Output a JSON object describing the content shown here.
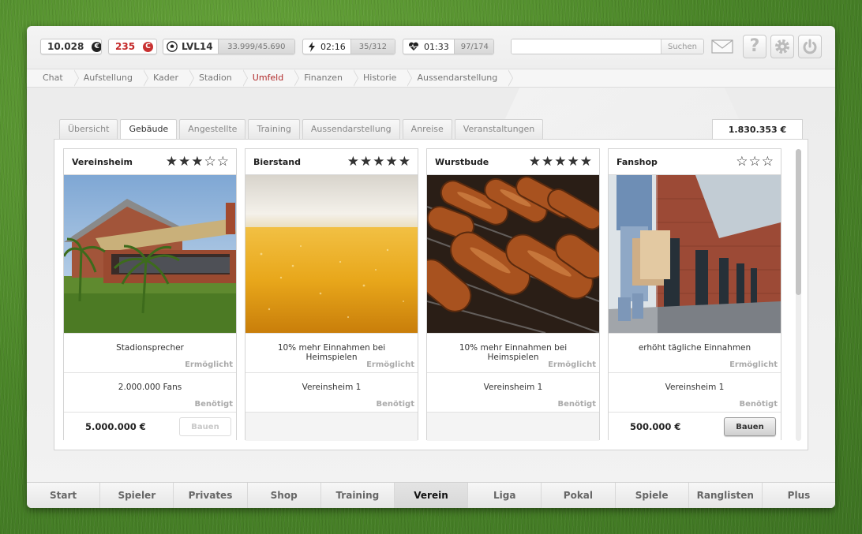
{
  "status": {
    "euro": "10.028",
    "euro_symbol": "€",
    "credits": "235",
    "credits_symbol": "C",
    "level": "LVL14",
    "xp": "33.999/45.690",
    "energy_time": "02:16",
    "energy": "35/312",
    "health_time": "01:33",
    "health": "97/174"
  },
  "search": {
    "value": "",
    "button": "Suchen"
  },
  "breadcrumbs": [
    "Chat",
    "Aufstellung",
    "Kader",
    "Stadion",
    "Umfeld",
    "Finanzen",
    "Historie",
    "Aussendarstellung"
  ],
  "breadcrumb_active": "Umfeld",
  "tabs": [
    "Übersicht",
    "Gebäude",
    "Angestellte",
    "Training",
    "Aussendarstellung",
    "Anreise",
    "Veranstaltungen"
  ],
  "tab_active": "Gebäude",
  "balance": "1.830.353 €",
  "cards": [
    {
      "title": "Vereinsheim",
      "stars": "★★★☆☆",
      "effect": "Stadionsprecher",
      "effect_label": "Ermöglicht",
      "requirement": "2.000.000 Fans",
      "requirement_label": "Benötigt",
      "price": "5.000.000 €",
      "button": "Bauen",
      "button_enabled": false
    },
    {
      "title": "Bierstand",
      "stars": "★★★★★",
      "effect": "10% mehr Einnahmen bei Heimspielen",
      "effect_label": "Ermöglicht",
      "requirement": "Vereinsheim 1",
      "requirement_label": "Benötigt",
      "price": "",
      "button": ""
    },
    {
      "title": "Wurstbude",
      "stars": "★★★★★",
      "effect": "10% mehr Einnahmen bei Heimspielen",
      "effect_label": "Ermöglicht",
      "requirement": "Vereinsheim 1",
      "requirement_label": "Benötigt",
      "price": "",
      "button": ""
    },
    {
      "title": "Fanshop",
      "stars": "☆☆☆",
      "effect": "erhöht tägliche Einnahmen",
      "effect_label": "Ermöglicht",
      "requirement": "Vereinsheim 1",
      "requirement_label": "Benötigt",
      "price": "500.000 €",
      "button": "Bauen",
      "button_enabled": true
    }
  ],
  "bottom_nav": [
    "Start",
    "Spieler",
    "Privates",
    "Shop",
    "Training",
    "Verein",
    "Liga",
    "Pokal",
    "Spiele",
    "Ranglisten",
    "Plus"
  ],
  "bottom_nav_active": "Verein",
  "colors": {
    "accent_red": "#b02a2a",
    "text": "#333333"
  }
}
